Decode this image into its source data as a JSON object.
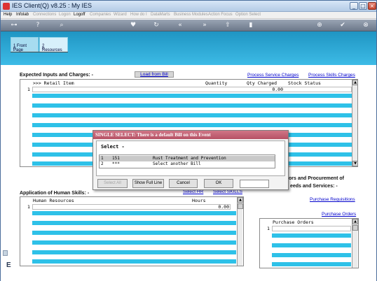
{
  "window": {
    "title": "IES Client(Q) v8.25 : My IES"
  },
  "menu": {
    "items": [
      {
        "label": "Help",
        "enabled": true
      },
      {
        "label": "Infolab",
        "enabled": true
      },
      {
        "label": "Connections",
        "enabled": false
      },
      {
        "label": "Logon",
        "enabled": false
      },
      {
        "label": "Logoff",
        "enabled": true
      },
      {
        "label": "Companies",
        "enabled": false
      },
      {
        "label": "Wizard",
        "enabled": false
      },
      {
        "label": "How do I",
        "enabled": false
      },
      {
        "label": "DataMarts",
        "enabled": false
      },
      {
        "label": "Business Modules",
        "enabled": false
      },
      {
        "label": "Action Focus",
        "enabled": false
      },
      {
        "label": "Option Select",
        "enabled": false
      }
    ]
  },
  "toolbar": {
    "icons": [
      "key-icon",
      "help-icon",
      "search-icon",
      "heart-icon",
      "refresh-icon",
      "back-icon",
      "forward-icon",
      "up-icon",
      "doc-icon",
      "add-icon",
      "check-icon",
      "close-icon"
    ]
  },
  "tabs": [
    {
      "key": "1",
      "label": " Front Page"
    },
    {
      "key": "2",
      "label": " Resources"
    }
  ],
  "inputs_section": {
    "title": "Expected Inputs and Charges: -",
    "load_from_bill": "Load from Bill",
    "process_service_charges": "Process Service Charges",
    "process_skills_charges": "Process Skills Charges",
    "columns": [
      ">>> Retail Item",
      "Quantity",
      "Qty Charged",
      "Stock Status"
    ],
    "first_row": {
      "num": "1",
      "qty_charged": "0.00"
    }
  },
  "human_section": {
    "title": "Application of Human Skills: -",
    "select_hr": "Select HR",
    "select_skills": "Select SKILLS",
    "columns": [
      "Human Resources",
      "Hours"
    ],
    "first_row": {
      "num": "1",
      "hours": "0.00"
    }
  },
  "procurement_section": {
    "title_line1": "ors and Procurement of",
    "title_line2": "eeds and Services: -",
    "purchase_requisitions": "Purchase Requisitions",
    "purchase_orders": "Purchase Orders",
    "columns": [
      "Purchase Orders"
    ],
    "first_row": {
      "num": "1"
    }
  },
  "dialog": {
    "title": "SINGLE SELECT: There is a default Bill on this Event",
    "heading": "Select -",
    "rows": [
      {
        "num": "1",
        "code": "151",
        "desc": "Rust Treatment and Prevention"
      },
      {
        "num": "2",
        "code": "***",
        "desc": "Select another Bill"
      }
    ],
    "buttons": {
      "select_all": "Select All",
      "show_full_line": "Show Full Line",
      "cancel": "Cancel",
      "ok": "OK"
    },
    "input_value": ""
  },
  "left_edge_letter": "E"
}
